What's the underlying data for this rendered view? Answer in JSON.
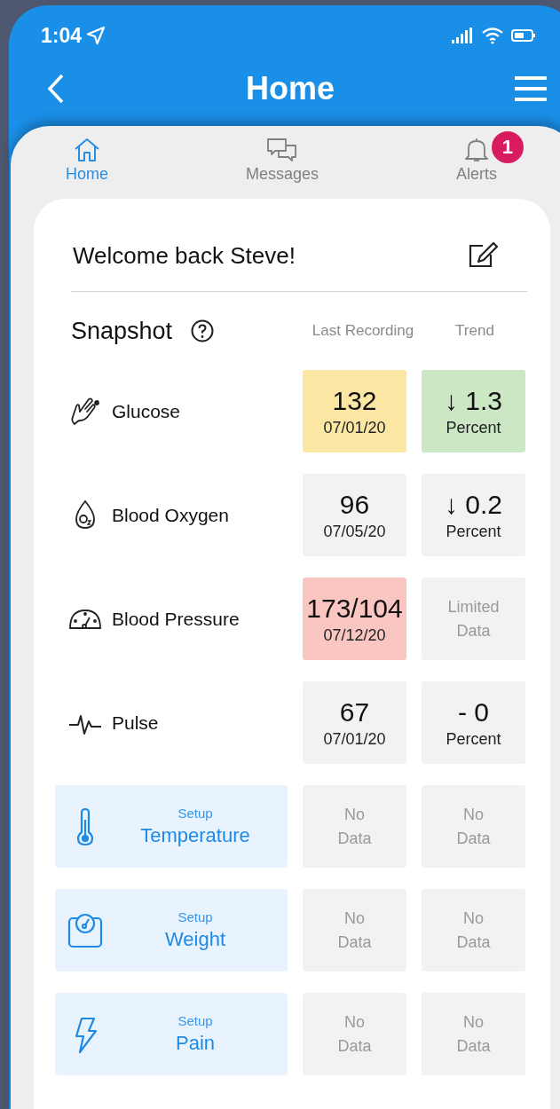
{
  "status_bar": {
    "time": "1:04"
  },
  "header": {
    "title": "Home"
  },
  "tabs": [
    {
      "label": "Home",
      "selected": true
    },
    {
      "label": "Messages",
      "selected": false
    },
    {
      "label": "Alerts",
      "selected": false,
      "badge": "1"
    }
  ],
  "welcome": "Welcome back Steve!",
  "snapshot": {
    "title": "Snapshot",
    "columns": [
      "Last Recording",
      "Trend"
    ]
  },
  "metrics": [
    {
      "kind": "reading",
      "name": "Glucose",
      "cells": [
        {
          "kind": "value",
          "value": "132",
          "sub": "07/01/20",
          "color": "#fce6a4"
        },
        {
          "kind": "value",
          "value": "↓ 1.3",
          "sub": "Percent",
          "color": "#cbe7c4"
        }
      ]
    },
    {
      "kind": "reading",
      "name": "Blood Oxygen",
      "cells": [
        {
          "kind": "value",
          "value": "96",
          "sub": "07/05/20",
          "color": "#f2f2f2"
        },
        {
          "kind": "value",
          "value": "↓ 0.2",
          "sub": "Percent",
          "color": "#f2f2f2"
        }
      ]
    },
    {
      "kind": "reading",
      "name": "Blood Pressure",
      "cells": [
        {
          "kind": "value",
          "value": "173/104",
          "sub": "07/12/20",
          "color": "#f9c6c1"
        },
        {
          "kind": "note",
          "lines": [
            "Limited",
            "Data"
          ],
          "color": "#f2f2f2"
        }
      ]
    },
    {
      "kind": "reading",
      "name": "Pulse",
      "cells": [
        {
          "kind": "value",
          "value": "67",
          "sub": "07/01/20",
          "color": "#f2f2f2"
        },
        {
          "kind": "value",
          "value": "- 0",
          "sub": "Percent",
          "color": "#f2f2f2"
        }
      ]
    },
    {
      "kind": "setup",
      "action": "Setup",
      "name": "Temperature",
      "cells": [
        {
          "kind": "note",
          "lines": [
            "No",
            "Data"
          ],
          "color": "#f2f2f2"
        },
        {
          "kind": "note",
          "lines": [
            "No",
            "Data"
          ],
          "color": "#f2f2f2"
        }
      ]
    },
    {
      "kind": "setup",
      "action": "Setup",
      "name": "Weight",
      "cells": [
        {
          "kind": "note",
          "lines": [
            "No",
            "Data"
          ],
          "color": "#f2f2f2"
        },
        {
          "kind": "note",
          "lines": [
            "No",
            "Data"
          ],
          "color": "#f2f2f2"
        }
      ]
    },
    {
      "kind": "setup",
      "action": "Setup",
      "name": "Pain",
      "cells": [
        {
          "kind": "note",
          "lines": [
            "No",
            "Data"
          ],
          "color": "#f2f2f2"
        },
        {
          "kind": "note",
          "lines": [
            "No",
            "Data"
          ],
          "color": "#f2f2f2"
        }
      ]
    }
  ]
}
